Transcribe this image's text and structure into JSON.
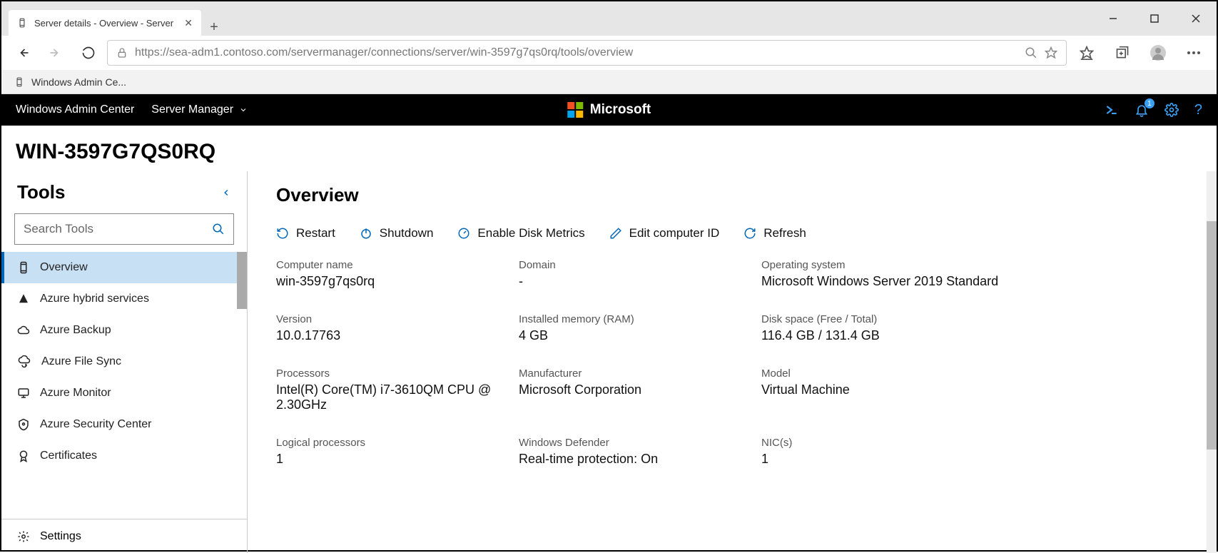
{
  "browser": {
    "tab_title": "Server details - Overview - Server",
    "url": "https://sea-adm1.contoso.com/servermanager/connections/server/win-3597g7qs0rq/tools/overview",
    "bookmark": "Windows Admin Ce..."
  },
  "wac": {
    "brand": "Windows Admin Center",
    "dropdown": "Server Manager",
    "microsoft": "Microsoft",
    "notifications_count": "1"
  },
  "server": {
    "name": "WIN-3597G7QS0RQ"
  },
  "sidebar": {
    "title": "Tools",
    "search_placeholder": "Search Tools",
    "items": [
      {
        "label": "Overview"
      },
      {
        "label": "Azure hybrid services"
      },
      {
        "label": "Azure Backup"
      },
      {
        "label": "Azure File Sync"
      },
      {
        "label": "Azure Monitor"
      },
      {
        "label": "Azure Security Center"
      },
      {
        "label": "Certificates"
      }
    ],
    "settings": "Settings"
  },
  "page": {
    "title": "Overview",
    "actions": {
      "restart": "Restart",
      "shutdown": "Shutdown",
      "disk": "Enable Disk Metrics",
      "edit": "Edit computer ID",
      "refresh": "Refresh"
    },
    "fields": {
      "computer_name": {
        "label": "Computer name",
        "value": "win-3597g7qs0rq"
      },
      "domain": {
        "label": "Domain",
        "value": "-"
      },
      "os": {
        "label": "Operating system",
        "value": "Microsoft Windows Server 2019 Standard"
      },
      "version": {
        "label": "Version",
        "value": "10.0.17763"
      },
      "ram": {
        "label": "Installed memory (RAM)",
        "value": "4 GB"
      },
      "disk": {
        "label": "Disk space (Free / Total)",
        "value": "116.4 GB / 131.4 GB"
      },
      "proc": {
        "label": "Processors",
        "value": "Intel(R) Core(TM) i7-3610QM CPU @ 2.30GHz"
      },
      "mfr": {
        "label": "Manufacturer",
        "value": "Microsoft Corporation"
      },
      "model": {
        "label": "Model",
        "value": "Virtual Machine"
      },
      "lproc": {
        "label": "Logical processors",
        "value": "1"
      },
      "defender": {
        "label": "Windows Defender",
        "value": "Real-time protection: On"
      },
      "nic": {
        "label": "NIC(s)",
        "value": "1"
      }
    }
  }
}
